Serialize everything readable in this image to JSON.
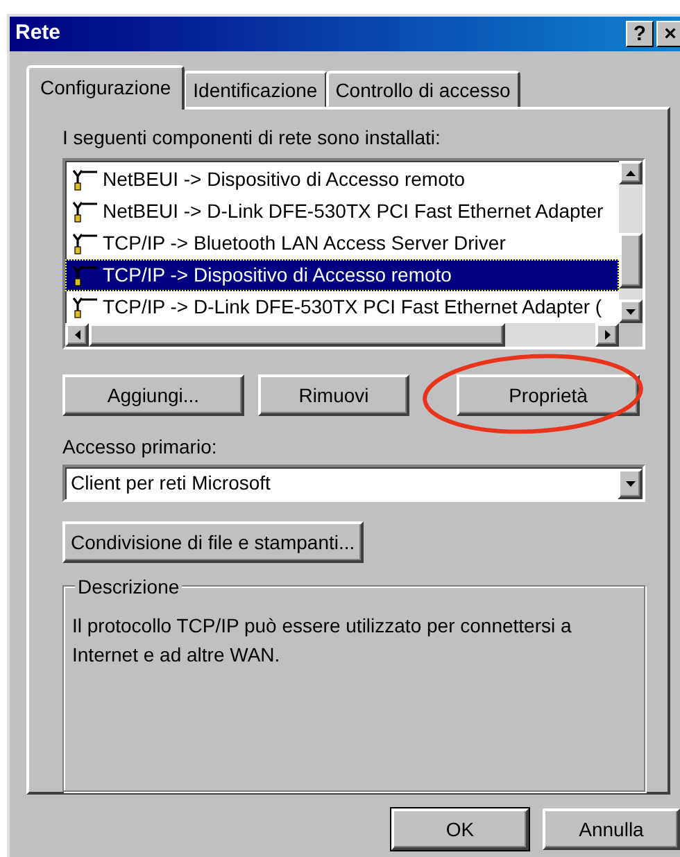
{
  "window": {
    "title": "Rete",
    "help_button": "?",
    "close_button": "×"
  },
  "tabs": [
    {
      "label": "Configurazione",
      "selected": true
    },
    {
      "label": "Identificazione",
      "selected": false
    },
    {
      "label": "Controllo di accesso",
      "selected": false
    }
  ],
  "components": {
    "label": "I seguenti componenti di rete sono installati:",
    "items": [
      {
        "text": "NetBEUI -> Dispositivo di Accesso remoto",
        "selected": false
      },
      {
        "text": "NetBEUI -> D-Link DFE-530TX PCI Fast Ethernet Adapter",
        "selected": false
      },
      {
        "text": "TCP/IP -> Bluetooth LAN Access Server Driver",
        "selected": false
      },
      {
        "text": "TCP/IP -> Dispositivo di Accesso remoto",
        "selected": true
      },
      {
        "text": "TCP/IP -> D-Link DFE-530TX PCI Fast Ethernet Adapter (",
        "selected": false
      }
    ]
  },
  "component_buttons": [
    {
      "label": "Aggiungi...",
      "highlighted": false
    },
    {
      "label": "Rimuovi",
      "highlighted": false
    },
    {
      "label": "Proprietà",
      "highlighted": true
    }
  ],
  "primary_access": {
    "label": "Accesso primario:",
    "value": "Client per reti Microsoft"
  },
  "sharing_button": "Condivisione di file e stampanti...",
  "description": {
    "title": "Descrizione",
    "text": "Il protocollo TCP/IP può essere utilizzato per connettersi a Internet e ad altre WAN."
  },
  "dialog_buttons": [
    {
      "label": "OK",
      "default": true
    },
    {
      "label": "Annulla",
      "default": false
    }
  ]
}
